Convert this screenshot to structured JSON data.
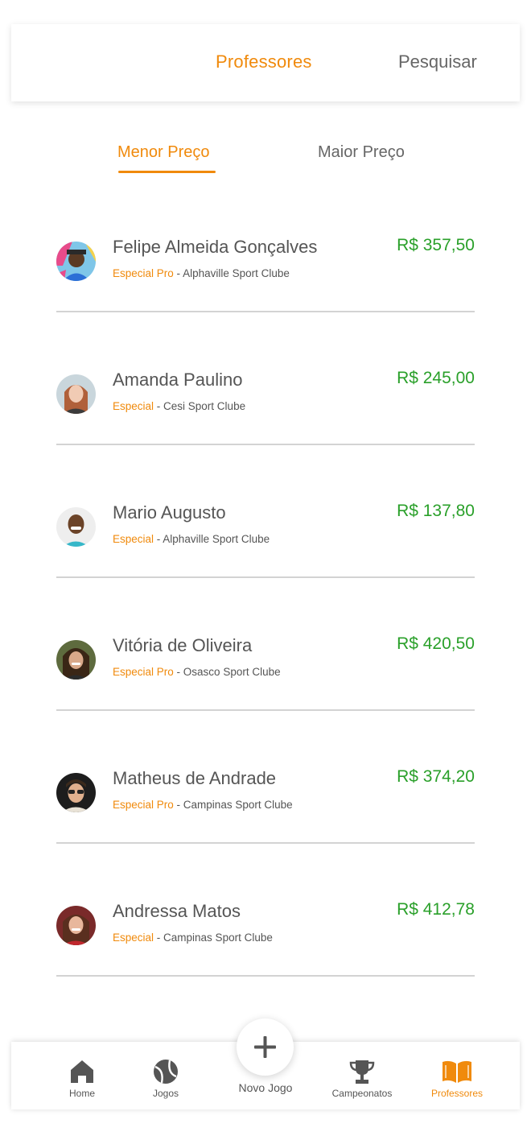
{
  "header": {
    "title": "Professores",
    "search": "Pesquisar"
  },
  "tabs": {
    "low": "Menor Preço",
    "high": "Maior Preço"
  },
  "teachers": [
    {
      "name": "Felipe Almeida Gonçalves",
      "level": "Especial Pro",
      "separator": " - ",
      "club": "Alphaville Sport Clube",
      "price": "R$ 357,50"
    },
    {
      "name": "Amanda Paulino",
      "level": "Especial",
      "separator": " - ",
      "club": "Cesi Sport Clube",
      "price": "R$ 245,00"
    },
    {
      "name": "Mario Augusto",
      "level": "Especial",
      "separator": " - ",
      "club": "Alphaville Sport Clube",
      "price": "R$ 137,80"
    },
    {
      "name": "Vitória de Oliveira",
      "level": "Especial Pro",
      "separator": " - ",
      "club": "Osasco Sport Clube",
      "price": "R$ 420,50"
    },
    {
      "name": "Matheus de Andrade",
      "level": "Especial Pro",
      "separator": " - ",
      "club": "Campinas Sport Clube",
      "price": "R$ 374,20"
    },
    {
      "name": "Andressa Matos",
      "level": "Especial",
      "separator": " - ",
      "club": "Campinas Sport Clube",
      "price": "R$ 412,78"
    }
  ],
  "nav": {
    "home": "Home",
    "jogos": "Jogos",
    "novo_jogo": "Novo Jogo",
    "campeonatos": "Campeonatos",
    "professores": "Professores"
  },
  "colors": {
    "accent": "#f08a0c",
    "price": "#2aa02a",
    "icon": "#555555"
  }
}
